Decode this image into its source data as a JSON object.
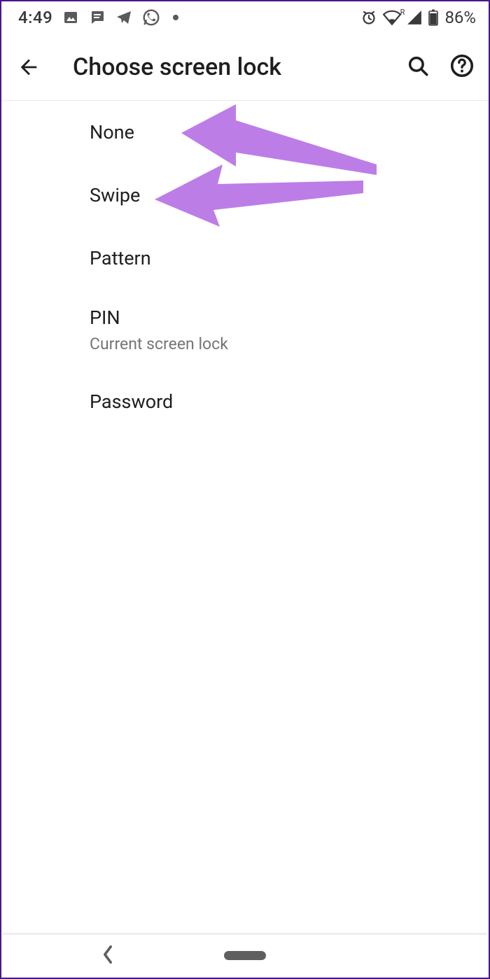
{
  "status_bar": {
    "time": "4:49",
    "battery_percent": "86%",
    "roaming_label": "R"
  },
  "app_bar": {
    "title": "Choose screen lock"
  },
  "options": [
    {
      "label": "None",
      "sub": null
    },
    {
      "label": "Swipe",
      "sub": null
    },
    {
      "label": "Pattern",
      "sub": null
    },
    {
      "label": "PIN",
      "sub": "Current screen lock"
    },
    {
      "label": "Password",
      "sub": null
    }
  ],
  "annotation": {
    "color": "#bd7de7"
  }
}
